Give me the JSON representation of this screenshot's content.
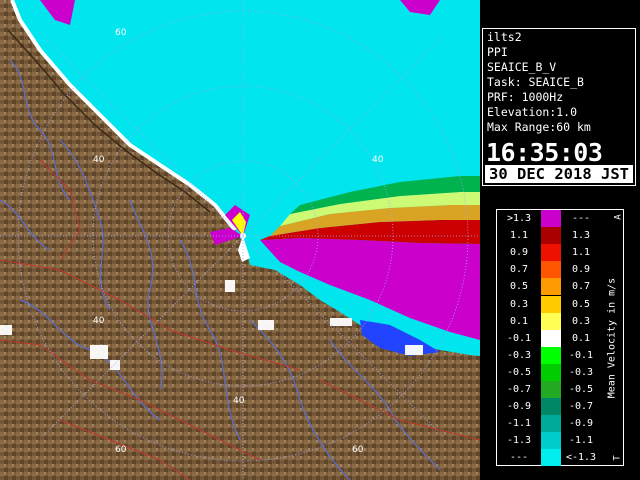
{
  "radar": {
    "name": "ilts2",
    "display_mode": "PPI",
    "product": "SEAICE_B_V",
    "task": "Task: SEAICE_B",
    "prf": "PRF: 1000Hz",
    "elevation": "Elevation:1.0",
    "max_range": "Max Range:60 km",
    "time": "16:35:03",
    "date": "30 DEC 2018 JST"
  },
  "range_labels": [
    "60",
    "40",
    "40",
    "40",
    "40",
    "60",
    "60"
  ],
  "legend": {
    "title": "Mean Velocity in m/s",
    "corner_top": "A",
    "corner_bottom": "T",
    "rows": [
      {
        "left": ">1.3",
        "right": "---",
        "color": "#cc00cc"
      },
      {
        "left": "1.1",
        "right": "1.3",
        "color": "#aa0000"
      },
      {
        "left": "0.9",
        "right": "1.1",
        "color": "#ee1100"
      },
      {
        "left": "0.7",
        "right": "0.9",
        "color": "#ff5500"
      },
      {
        "left": "0.5",
        "right": "0.7",
        "color": "#ff9900"
      },
      {
        "left": "0.3",
        "right": "0.5",
        "color": "#ffcc00"
      },
      {
        "left": "0.1",
        "right": "0.3",
        "color": "#ffff55"
      },
      {
        "left": "-0.1",
        "right": "0.1",
        "color": "#ffffff"
      },
      {
        "left": "-0.3",
        "right": "-0.1",
        "color": "#00ff00"
      },
      {
        "left": "-0.5",
        "right": "-0.3",
        "color": "#00cc00"
      },
      {
        "left": "-0.7",
        "right": "-0.5",
        "color": "#22aa22"
      },
      {
        "left": "-0.9",
        "right": "-0.7",
        "color": "#008866"
      },
      {
        "left": "-1.1",
        "right": "-0.9",
        "color": "#00aa99"
      },
      {
        "left": "-1.3",
        "right": "-1.1",
        "color": "#00cccc"
      },
      {
        "left": "---",
        "right": "<-1.3",
        "color": "#00eeee"
      }
    ]
  },
  "colors": {
    "sea": "#00e5ee",
    "land": "#7a5c3a",
    "land_dark": "#5b4127",
    "coast": "#ffffff"
  }
}
